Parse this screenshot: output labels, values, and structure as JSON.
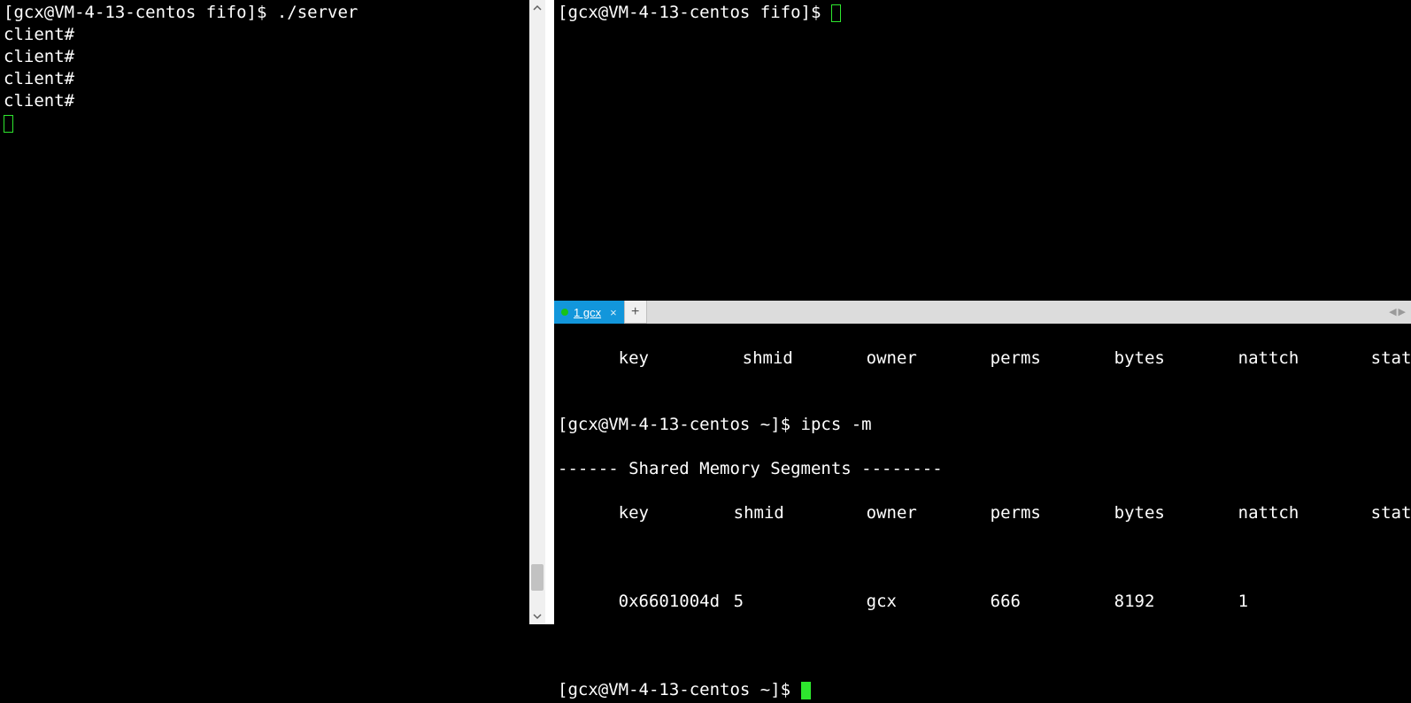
{
  "left": {
    "prompt": "[gcx@VM-4-13-centos fifo]$ ",
    "command": "./server",
    "output": [
      "client#",
      "client#",
      "client#",
      "client#"
    ]
  },
  "right_top": {
    "prompt": "[gcx@VM-4-13-centos fifo]$ "
  },
  "tabs": {
    "active_label": "1 gcx",
    "add_label": "+"
  },
  "right_bottom": {
    "header_line1": {
      "cols": [
        "key",
        "shmid",
        "owner",
        "perms",
        "bytes",
        "nattch",
        "status"
      ]
    },
    "prompt1": "[gcx@VM-4-13-centos ~]$ ",
    "command1": "ipcs -m",
    "section_title": "------ Shared Memory Segments --------",
    "header_line2": {
      "cols": [
        "key",
        "shmid",
        "owner",
        "perms",
        "bytes",
        "nattch",
        "status"
      ]
    },
    "row": {
      "key": "0x6601004d",
      "shmid": "5",
      "owner": "gcx",
      "perms": "666",
      "bytes": "8192",
      "nattch": "1",
      "status": ""
    },
    "prompt2": "[gcx@VM-4-13-centos ~]$ "
  },
  "col_widths": {
    "c0": 140,
    "c1": 140,
    "c2": 140,
    "c3": 140,
    "c4": 140,
    "c5": 150,
    "c6": 110
  },
  "row_col_widths": {
    "c0": 140,
    "c1": 140,
    "c2": 140,
    "c3": 140,
    "c4": 140,
    "c5": 150,
    "c6": 110
  }
}
